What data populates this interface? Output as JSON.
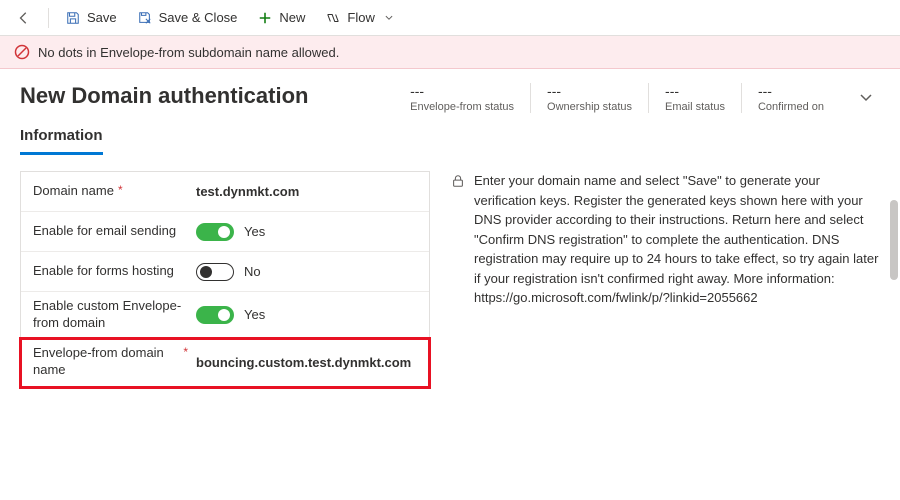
{
  "toolbar": {
    "save": "Save",
    "save_close": "Save & Close",
    "new": "New",
    "flow": "Flow"
  },
  "alert": {
    "message": "No dots in Envelope-from subdomain name allowed."
  },
  "page_title": "New Domain authentication",
  "status": {
    "envelope": {
      "value": "---",
      "label": "Envelope-from status"
    },
    "ownership": {
      "value": "---",
      "label": "Ownership status"
    },
    "email": {
      "value": "---",
      "label": "Email status"
    },
    "confirmed": {
      "value": "---",
      "label": "Confirmed on"
    }
  },
  "tab_label": "Information",
  "fields": {
    "domain_name": {
      "label": "Domain name",
      "value": "test.dynmkt.com"
    },
    "email_sending": {
      "label": "Enable for email sending",
      "value_text": "Yes"
    },
    "forms_hosting": {
      "label": "Enable for forms hosting",
      "value_text": "No"
    },
    "custom_envelope": {
      "label": "Enable custom Envelope-from domain",
      "value_text": "Yes"
    },
    "envelope_name": {
      "label": "Envelope-from domain name",
      "value": "bouncing.custom.test.dynmkt.com"
    }
  },
  "help_text": "Enter your domain name and select \"Save\" to generate your verification keys. Register the generated keys shown here with your DNS provider according to their instructions. Return here and select \"Confirm DNS registration\" to complete the authentication. DNS registration may require up to 24 hours to take effect, so try again later if your registration isn't confirmed right away. More information: https://go.microsoft.com/fwlink/p/?linkid=2055662"
}
